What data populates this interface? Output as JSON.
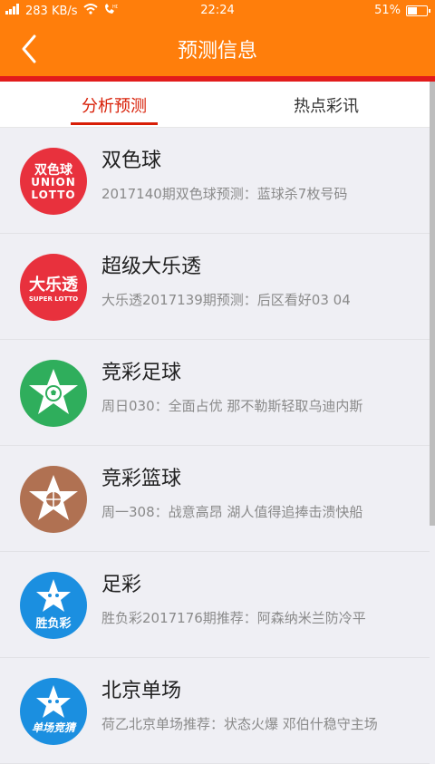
{
  "status_bar": {
    "network_speed": "283 KB/s",
    "time": "22:24",
    "battery": "51%",
    "battery_level": 0.51
  },
  "header": {
    "title": "预测信息"
  },
  "tabs": [
    {
      "label": "分析预测",
      "active": true
    },
    {
      "label": "热点彩讯",
      "active": false
    }
  ],
  "items": [
    {
      "name": "双色球",
      "desc": "2017140期双色球预测：蓝球杀7枚号码",
      "logo_bg": "#e8313d",
      "logo_text": [
        "双色球",
        "UNION",
        "LOTTO"
      ]
    },
    {
      "name": "超级大乐透",
      "desc": "大乐透2017139期预测：后区看好03 04",
      "logo_bg": "#e8313d",
      "logo_text": [
        "大乐透",
        "SUPER LOTTO"
      ]
    },
    {
      "name": "竞彩足球",
      "desc": "周日030：全面占优 那不勒斯轻取乌迪内斯",
      "logo_bg": "#2fae5c",
      "logo_text": []
    },
    {
      "name": "竞彩篮球",
      "desc": "周一308：战意高昂 湖人值得追捧击溃快船",
      "logo_bg": "#b07152",
      "logo_text": []
    },
    {
      "name": "足彩",
      "desc": "胜负彩2017176期推荐：阿森纳米兰防冷平",
      "logo_bg": "#1b8fe0",
      "logo_text": [
        "胜负彩"
      ]
    },
    {
      "name": "北京单场",
      "desc": "荷乙北京单场推荐：状态火爆 邓伯什稳守主场",
      "logo_bg": "#1b8fe0",
      "logo_text": [
        "单场竞猜"
      ]
    }
  ],
  "icons": {
    "back": "chevron-left-icon",
    "wifi": "wifi-icon",
    "signal": "signal-icon",
    "hd_call": "hd-call-icon",
    "battery": "battery-icon"
  }
}
